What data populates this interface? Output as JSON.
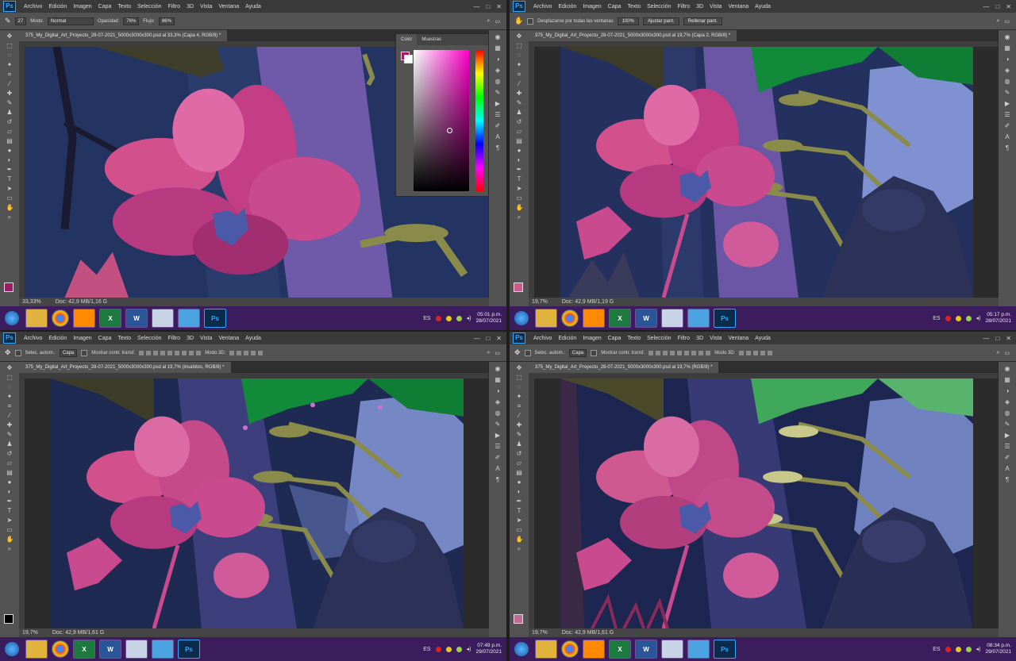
{
  "menus": [
    "Archivo",
    "Edición",
    "Imagen",
    "Capa",
    "Texto",
    "Selección",
    "Filtro",
    "3D",
    "Vista",
    "Ventana",
    "Ayuda"
  ],
  "colors": {
    "menubar": "#3a3a3a",
    "panel": "#535353",
    "taskbar": "#3b1d5e",
    "ps_blue": "#31a8ff",
    "fg_swatch": "#9b1b67"
  },
  "icons": [
    "photoshop-logo",
    "brush-tool-icon",
    "move-tool-icon",
    "lasso-icon",
    "crop-icon",
    "eyedropper-icon",
    "eraser-icon",
    "gradient-icon",
    "pen-icon",
    "text-icon",
    "hand-icon",
    "zoom-icon",
    "windows-start-icon"
  ],
  "quadrants": [
    {
      "id": "q1",
      "options_bar": {
        "mode_label": "Modo:",
        "mode_value": "Normal",
        "opacity_label": "Opacidad:",
        "opacity_value": "76%",
        "flow_label": "Flujo:",
        "flow_value": "86%"
      },
      "tab": "375_My_Digital_Art_Proyecto_28-07-2021_5000x3000x300.psd al 33,3% (Capa 4, RGB/8) *",
      "status": {
        "zoom": "33,33%",
        "doc": "Doc: 42,9 MB/1,16 G"
      },
      "taskbar": {
        "lang": "ES",
        "time": "05:01 p.m.",
        "date": "28/07/2021"
      },
      "color_panel": {
        "tab1": "Color",
        "tab2": "Muestras"
      }
    },
    {
      "id": "q2",
      "options_bar": {
        "scroll_all": "Desplazarse por todas las ventanas",
        "zoom_btn": "100%",
        "fit_btn": "Ajustar pant.",
        "fill_btn": "Rellenar pant."
      },
      "tab": "375_My_Digital_Art_Proyecto_28-07-2021_5000x3000x300.psd al 19,7% (Capa 2, RGB/8) *",
      "status": {
        "zoom": "19,7%",
        "doc": "Doc: 42,9 MB/1,19 G"
      },
      "taskbar": {
        "lang": "ES",
        "time": "05:17 p.m.",
        "date": "28/07/2021"
      }
    },
    {
      "id": "q3",
      "options_bar": {
        "auto_select": "Selec. autom.:",
        "layer": "Capa",
        "show_transform": "Mostrar contr. transf.",
        "mode3d": "Modo 3D:"
      },
      "tab": "375_My_Digital_Art_Proyecto_28-07-2021_5000x3000x300.psd al 19,7% (insabitos, RGB/8) *",
      "status": {
        "zoom": "19,7%",
        "doc": "Doc: 42,9 MB/1,61 G"
      },
      "taskbar": {
        "lang": "ES",
        "time": "07:49 p.m.",
        "date": "29/07/2021"
      }
    },
    {
      "id": "q4",
      "options_bar": {
        "auto_select": "Selec. autom.:",
        "layer": "Capa",
        "show_transform": "Mostrar contr. transf.",
        "mode3d": "Modo 3D:"
      },
      "tab": "375_My_Digital_Art_Proyecto_28-07-2021_5000x3000x300.psd al 19,7% (RGB/8) *",
      "status": {
        "zoom": "19,7%",
        "doc": "Doc: 42,9 MB/1,61 G"
      },
      "taskbar": {
        "lang": "ES",
        "time": "08:34 p.m.",
        "date": "29/07/2021"
      }
    }
  ]
}
